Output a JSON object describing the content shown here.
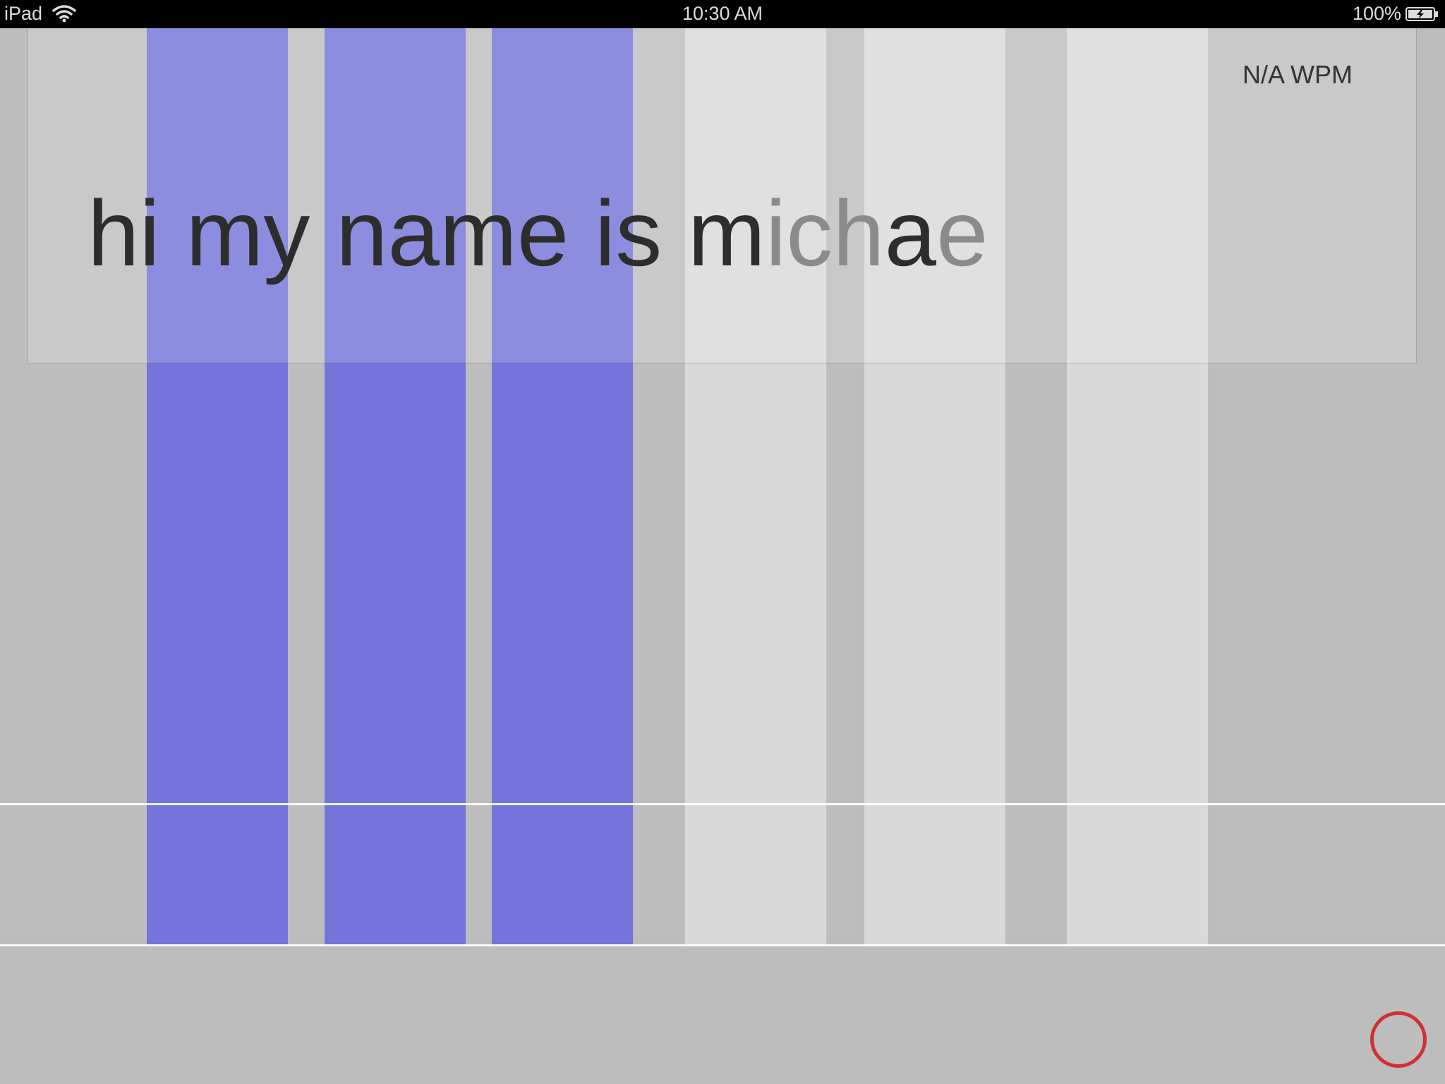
{
  "status_bar": {
    "device": "iPad",
    "time": "10:30 AM",
    "battery": "100%"
  },
  "stats": {
    "wpm": "N/A WPM"
  },
  "text": {
    "typed": "hi my name is m",
    "pending_before": "ich",
    "current_char": "a",
    "pending_after": "e"
  },
  "colors": {
    "key_active": "#7474da",
    "key_light": "#d9d9d9",
    "background": "#bdbdbd",
    "record_ring": "#d03033"
  },
  "keys": [
    {
      "state": "idle"
    },
    {
      "state": "active"
    },
    {
      "state": "active"
    },
    {
      "state": "active"
    },
    {
      "state": "light"
    },
    {
      "state": "light"
    },
    {
      "state": "light"
    },
    {
      "state": "idle"
    }
  ]
}
